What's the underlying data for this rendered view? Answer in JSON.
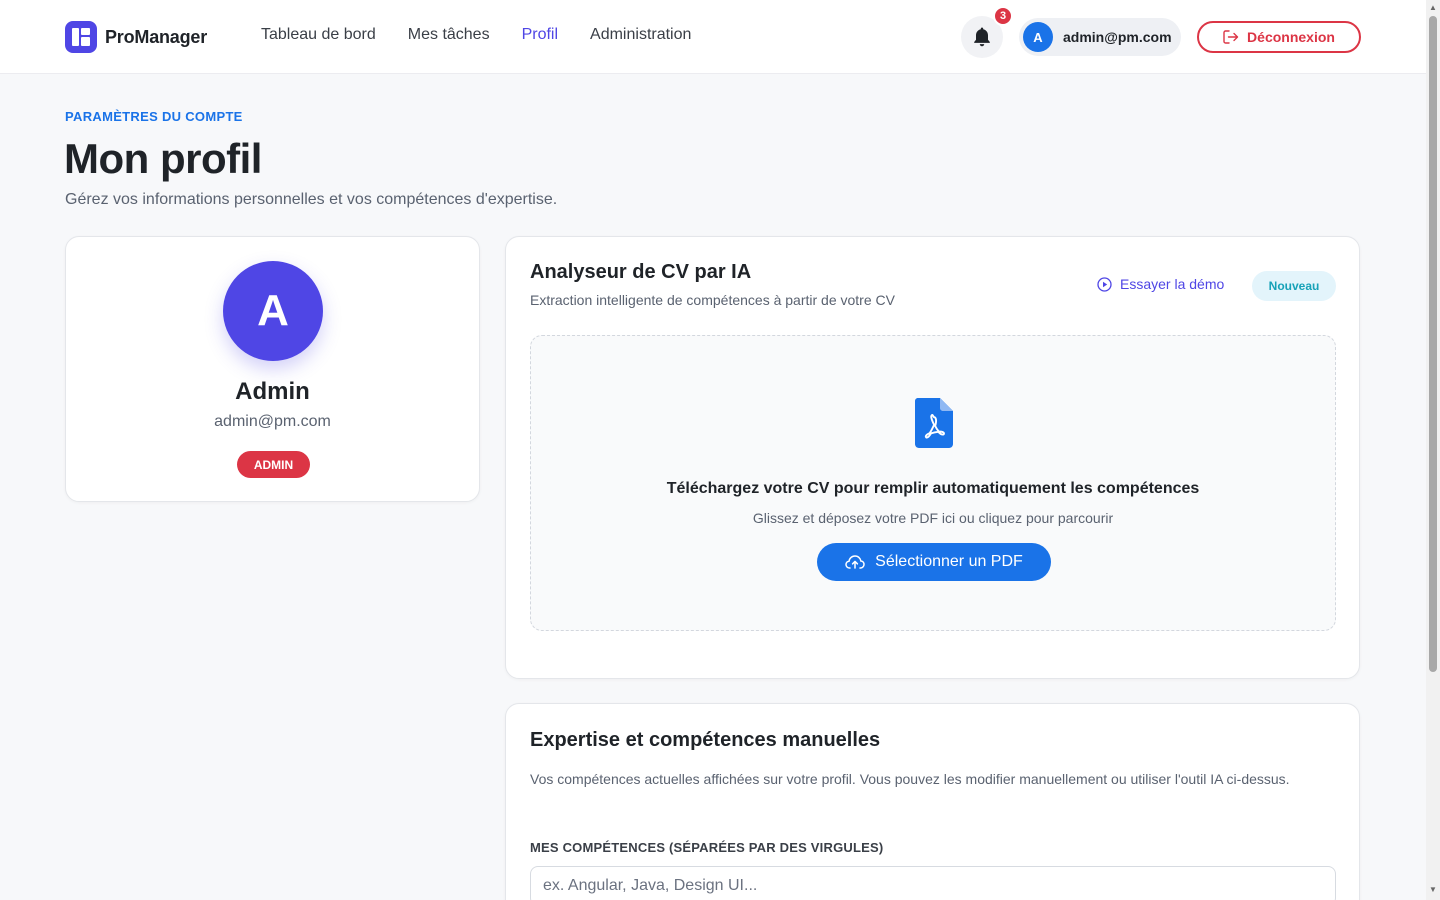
{
  "header": {
    "brand": "ProManager",
    "nav": [
      {
        "label": "Tableau de bord"
      },
      {
        "label": "Mes tâches"
      },
      {
        "label": "Profil"
      },
      {
        "label": "Administration"
      }
    ],
    "active_nav": "Profil",
    "notifications_count": "3",
    "user_initial": "A",
    "user_email": "admin@pm.com",
    "logout_label": "Déconnexion"
  },
  "page": {
    "eyebrow": "PARAMÈTRES DU COMPTE",
    "title": "Mon profil",
    "subtitle": "Gérez vos informations personnelles et vos compétences d'expertise."
  },
  "profile": {
    "initial": "A",
    "name": "Admin",
    "email": "admin@pm.com",
    "role": "ADMIN"
  },
  "cv_analyzer": {
    "title": "Analyseur de CV par IA",
    "subtitle": "Extraction intelligente de compétences à partir de votre CV",
    "demo_label": "Essayer la démo",
    "badge": "Nouveau",
    "drop_title": "Téléchargez votre CV pour remplir automatiquement les compétences",
    "drop_subtitle": "Glissez et déposez votre PDF ici ou cliquez pour parcourir",
    "button_label": "Sélectionner un PDF"
  },
  "skills": {
    "title": "Expertise et compétences manuelles",
    "description": "Vos compétences actuelles affichées sur votre profil. Vous pouvez les modifier manuellement ou utiliser l'outil IA ci-dessus.",
    "label": "MES COMPÉTENCES (SÉPARÉES PAR DES VIRGULES)",
    "placeholder": "ex. Angular, Java, Design UI...",
    "value": ""
  },
  "colors": {
    "primary": "#4f46e5",
    "accent_blue": "#1a73e8",
    "danger": "#dc3545",
    "info": "#17a2b8"
  },
  "icons": [
    "logo-icon",
    "bell-icon",
    "logout-icon",
    "play-circle-icon",
    "pdf-file-icon",
    "cloud-upload-icon"
  ]
}
